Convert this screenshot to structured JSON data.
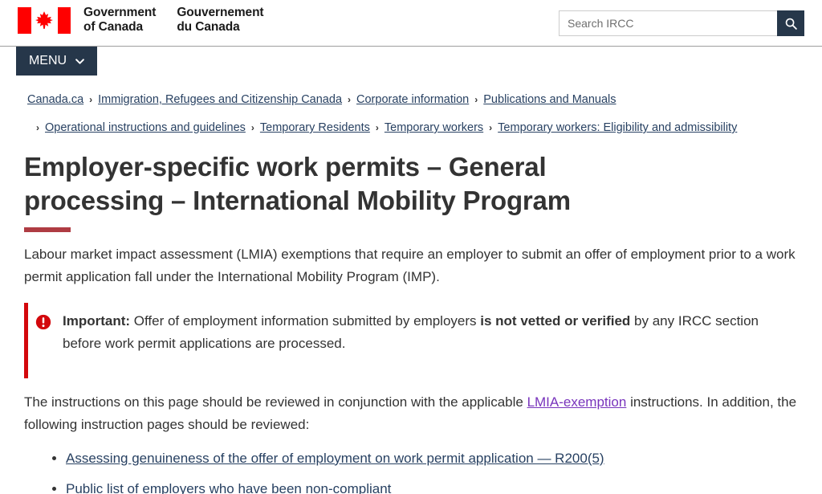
{
  "header": {
    "logo_alt": "Government of Canada / Gouvernement du Canada",
    "wordmark_en_line1": "Government",
    "wordmark_en_line2": "of Canada",
    "wordmark_fr_line1": "Gouvernement",
    "wordmark_fr_line2": "du Canada",
    "search": {
      "placeholder": "Search IRCC",
      "value": "",
      "button_icon": "search-icon"
    },
    "menu_label": "MENU",
    "menu_icon": "chevron-down-icon",
    "colors": {
      "nav_dark": "#26374A",
      "flag_red": "#FF0000"
    }
  },
  "breadcrumbs": {
    "separator": "›",
    "rows": [
      [
        {
          "label": "Canada.ca"
        },
        {
          "label": "Immigration, Refugees and Citizenship Canada"
        },
        {
          "label": "Corporate information"
        },
        {
          "label": "Publications and Manuals"
        }
      ],
      [
        {
          "label": "Operational instructions and guidelines"
        },
        {
          "label": "Temporary Residents"
        },
        {
          "label": "Temporary workers"
        },
        {
          "label": "Temporary workers: Eligibility and admissibility"
        }
      ]
    ]
  },
  "main": {
    "title": "Employer-specific work permits – General processing – International Mobility Program",
    "intro_paragraph": "Labour market impact assessment (LMIA) exemptions that require an employer to submit an offer of employment prior to a work permit application fall under the International Mobility Program (IMP).",
    "callout": {
      "icon": "exclamation-circle-icon",
      "label": "Important:",
      "text_before_bold": " Offer of employment information submitted by employers ",
      "bold_text": "is not vetted or verified",
      "text_after_bold": " by any IRCC section before work permit applications are processed.",
      "accent_color": "#D3080C"
    },
    "review_paragraph": {
      "before_link": "The instructions on this page should be reviewed in conjunction with the applicable ",
      "link_text": "LMIA-exemption",
      "after_link": " instructions. In addition, the following instruction pages should be reviewed:"
    },
    "list": [
      {
        "label": "Assessing genuineness of the offer of employment on work permit application — R200(5)"
      },
      {
        "label": "Public list of employers who have been non-compliant"
      }
    ],
    "colors": {
      "title_rule": "#AF3C43",
      "link_blue": "#284162",
      "link_visited_purple": "#7834BC"
    }
  }
}
